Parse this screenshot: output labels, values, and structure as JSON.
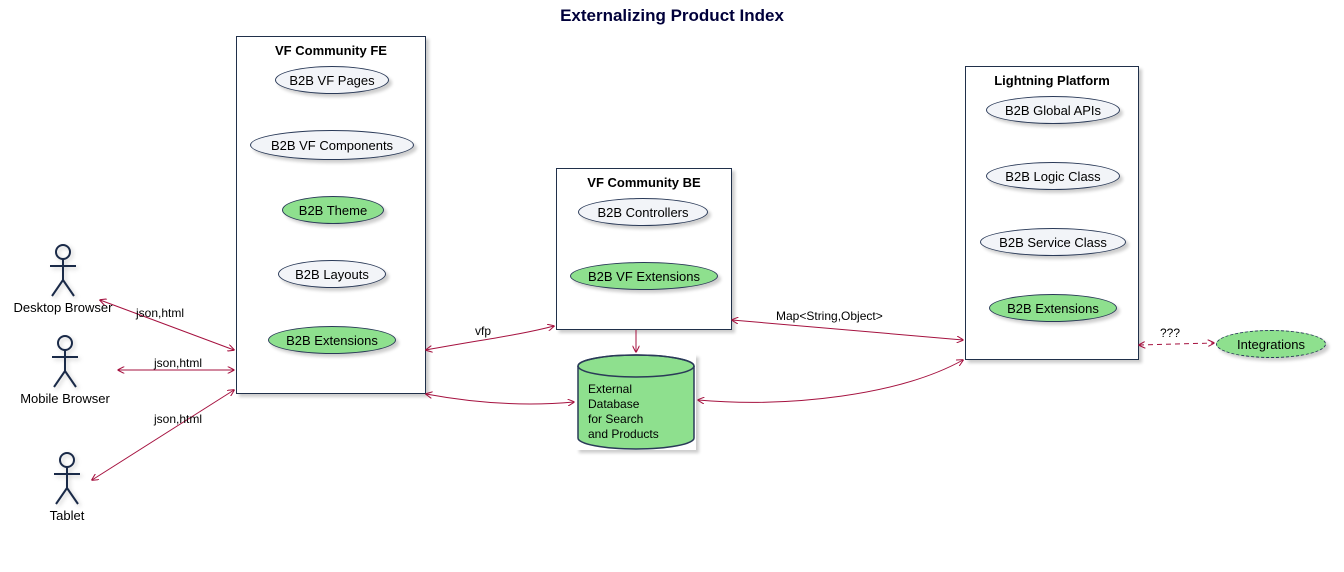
{
  "title": "Externalizing Product Index",
  "actors": {
    "desktop": "Desktop Browser",
    "mobile": "Mobile Browser",
    "tablet": "Tablet"
  },
  "packages": {
    "fe": {
      "title": "VF Community FE",
      "items": {
        "pages": "B2B VF Pages",
        "components": "B2B VF Components",
        "theme": "B2B Theme",
        "layouts": "B2B Layouts",
        "extensions": "B2B Extensions"
      }
    },
    "be": {
      "title": "VF Community BE",
      "items": {
        "controllers": "B2B Controllers",
        "vfext": "B2B VF Extensions"
      }
    },
    "lp": {
      "title": "Lightning Platform",
      "items": {
        "globalapis": "B2B Global APIs",
        "logic": "B2B Logic Class",
        "service": "B2B Service Class",
        "extensions": "B2B Extensions"
      }
    }
  },
  "integrations": "Integrations",
  "database": "External\nDatabase\nfor Search\nand Products",
  "edges": {
    "jsonhtml1": "json,html",
    "jsonhtml2": "json,html",
    "jsonhtml3": "json,html",
    "vfp": "vfp",
    "map": "Map<String,Object>",
    "qqq": "???"
  }
}
